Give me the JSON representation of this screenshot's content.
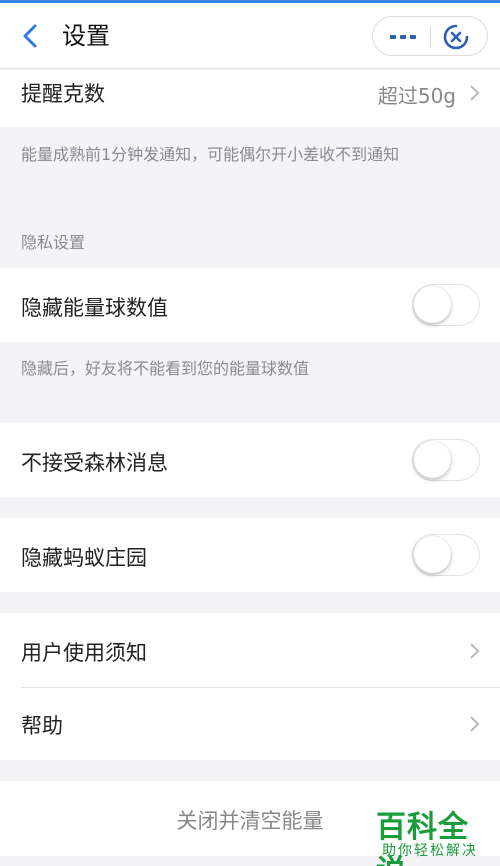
{
  "navbar": {
    "title": "设置"
  },
  "reminder": {
    "label": "提醒克数",
    "value": "超过50g",
    "hint": "能量成熟前1分钟发通知，可能偶尔开小差收不到通知"
  },
  "privacy": {
    "section_title": "隐私设置",
    "hide_energy": {
      "label": "隐藏能量球数值",
      "on": false
    },
    "hide_energy_hint": "隐藏后，好友将不能看到您的能量球数值"
  },
  "no_forest_messages": {
    "label": "不接受森林消息",
    "on": false
  },
  "hide_ant_farm": {
    "label": "隐藏蚂蚁庄园",
    "on": false
  },
  "links": {
    "user_notice": "用户使用须知",
    "help": "帮助"
  },
  "danger": {
    "close_clear": "关闭并清空能量"
  },
  "watermark": {
    "big": "百科全说",
    "small": "助你轻松解决"
  },
  "colors": {
    "accent": "#3a86e8",
    "watermark": "#1a9c3a"
  }
}
